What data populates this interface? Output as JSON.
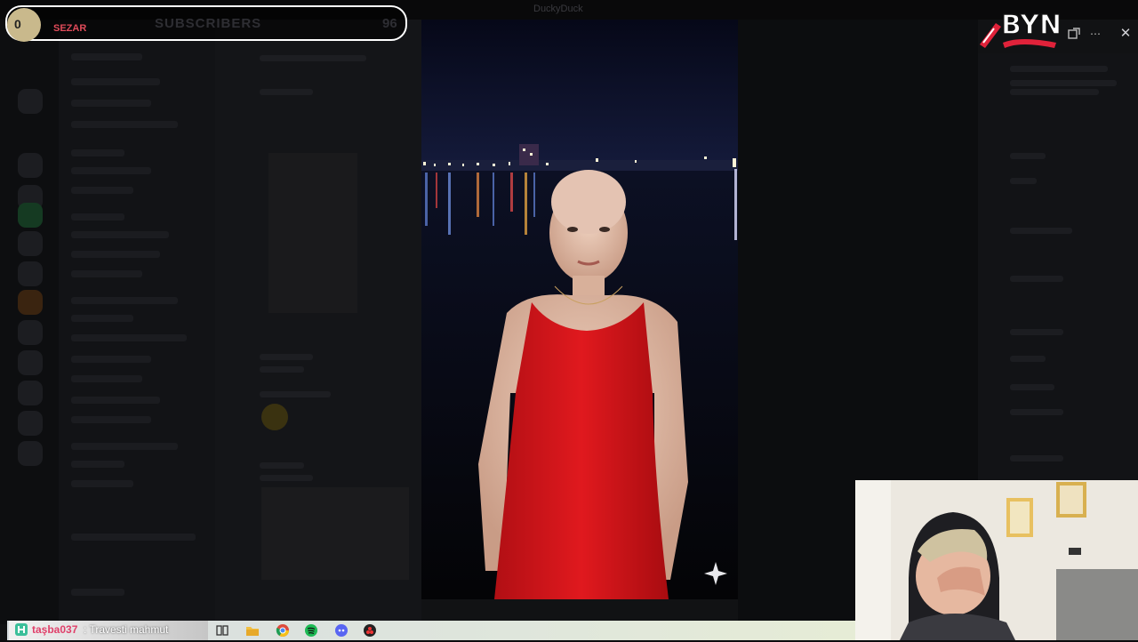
{
  "window": {
    "title": "DuckyDuck"
  },
  "subscriber_bar": {
    "count": "0",
    "name": "SEZAR",
    "title": "SUBSCRIBERS",
    "goal": "96"
  },
  "chat_overlay": {
    "username": "taşba037",
    "separator": " : ",
    "message": "Travesti mahmut"
  },
  "logo": {
    "text": "BYN"
  },
  "controls": {
    "close_icon": "close-icon",
    "more_icon": "more-icon"
  },
  "colors": {
    "accent_red": "#e0223a",
    "dress_red": "#d8161c",
    "sub_name": "#e14b5a"
  }
}
